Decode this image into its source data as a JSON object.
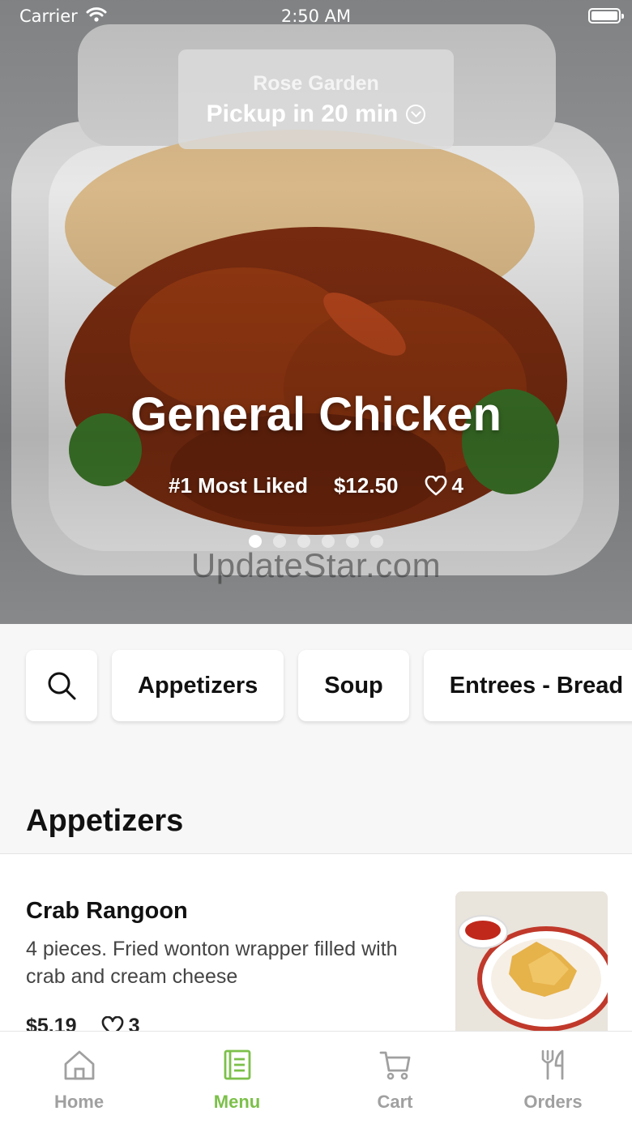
{
  "status_bar": {
    "carrier": "Carrier",
    "time": "2:50 AM"
  },
  "pickup": {
    "store": "Rose Garden",
    "time": "Pickup in 20 min"
  },
  "hero": {
    "title": "General Chicken",
    "rank": "#1 Most Liked",
    "price": "$12.50",
    "likes": "4",
    "slide_count": 6,
    "active_slide": 1,
    "watermark": "UpdateStar.com"
  },
  "categories": [
    "Appetizers",
    "Soup",
    "Entrees - Bread"
  ],
  "section": {
    "title": "Appetizers"
  },
  "items": [
    {
      "name": "Crab Rangoon",
      "description": "4 pieces. Fried wonton wrapper filled with crab and cream cheese",
      "price": "$5.19",
      "likes": "3"
    }
  ],
  "tabs": [
    {
      "label": "Home",
      "icon": "home-icon"
    },
    {
      "label": "Menu",
      "icon": "menu-icon",
      "active": true
    },
    {
      "label": "Cart",
      "icon": "cart-icon"
    },
    {
      "label": "Orders",
      "icon": "orders-icon"
    }
  ],
  "colors": {
    "accent": "#7cc04a",
    "inactive": "#a0a0a0"
  }
}
